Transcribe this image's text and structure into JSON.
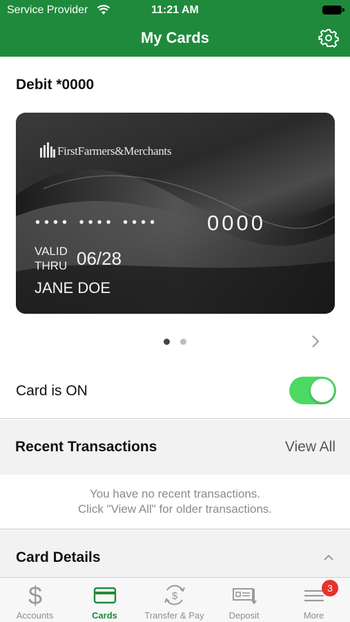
{
  "status_bar": {
    "carrier": "Service Provider",
    "time": "11:21 AM"
  },
  "header": {
    "title": "My Cards"
  },
  "card": {
    "title": "Debit *0000",
    "bank_name": "FirstFarmers&Merchants",
    "masked_groups": "•••• •••• ••••",
    "last4": "0000",
    "valid_line1": "VALID",
    "valid_line2": "THRU",
    "expiry": "06/28",
    "holder": "JANE DOE"
  },
  "pager": {
    "pages": 2,
    "current": 1
  },
  "card_toggle": {
    "label": "Card is ON",
    "on": true
  },
  "recent_transactions": {
    "label": "Recent Transactions",
    "view_all": "View All",
    "empty_line1": "You have no recent transactions.",
    "empty_line2": "Click \"View All\" for older transactions."
  },
  "card_details": {
    "label": "Card Details"
  },
  "tabbar": {
    "tabs": [
      {
        "label": "Accounts",
        "icon": "dollar-icon"
      },
      {
        "label": "Cards",
        "icon": "card-icon",
        "active": true
      },
      {
        "label": "Transfer & Pay",
        "icon": "transfer-icon"
      },
      {
        "label": "Deposit",
        "icon": "deposit-icon"
      },
      {
        "label": "More",
        "icon": "menu-icon",
        "badge": "3"
      }
    ]
  },
  "colors": {
    "brand": "#1f8a3c",
    "toggle_on": "#4cd964",
    "badge": "#e5332a"
  }
}
